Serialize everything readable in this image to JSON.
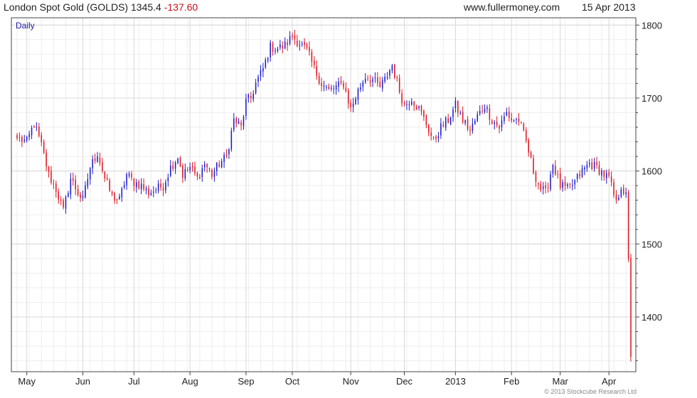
{
  "header": {
    "instrument": "London Spot Gold (GOLDS)",
    "last": "1345.4",
    "change": "-137.60",
    "site": "www.fullermoney.com",
    "date": "15 Apr 2013"
  },
  "footer": {
    "copyright": "© 2013 Stockcube Research Ltd"
  },
  "colors": {
    "up": "#1a1acc",
    "down": "#e0141e",
    "grid": "#d8d8d8",
    "frame": "#444444"
  },
  "chart_data": {
    "type": "candlestick",
    "period_label": "Daily",
    "ylim": [
      1325,
      1810
    ],
    "y_ticks": [
      1400,
      1500,
      1600,
      1700,
      1800
    ],
    "y_axis_side": "right",
    "grid": true,
    "x_ticks": [
      {
        "label": "May",
        "day": 4
      },
      {
        "label": "Jun",
        "day": 27
      },
      {
        "label": "Jul",
        "day": 48
      },
      {
        "label": "Aug",
        "day": 71
      },
      {
        "label": "Sep",
        "day": 94
      },
      {
        "label": "Oct",
        "day": 113
      },
      {
        "label": "Nov",
        "day": 137
      },
      {
        "label": "Dec",
        "day": 159
      },
      {
        "label": "2013",
        "day": 180
      },
      {
        "label": "Feb",
        "day": 203
      },
      {
        "label": "Mar",
        "day": 223
      },
      {
        "label": "Apr",
        "day": 243
      }
    ],
    "series": [
      {
        "comment": "",
        "close_path": [
          [
            0,
            1645
          ],
          [
            4,
            1640
          ],
          [
            7,
            1665
          ],
          [
            10,
            1635
          ],
          [
            13,
            1595
          ],
          [
            16,
            1575
          ],
          [
            19,
            1545
          ],
          [
            22,
            1590
          ],
          [
            25,
            1570
          ],
          [
            27,
            1560
          ],
          [
            30,
            1605
          ],
          [
            33,
            1625
          ],
          [
            36,
            1590
          ],
          [
            39,
            1565
          ],
          [
            42,
            1560
          ],
          [
            45,
            1595
          ],
          [
            48,
            1585
          ],
          [
            51,
            1580
          ],
          [
            54,
            1570
          ],
          [
            57,
            1575
          ],
          [
            60,
            1580
          ],
          [
            63,
            1605
          ],
          [
            66,
            1620
          ],
          [
            68,
            1595
          ],
          [
            71,
            1605
          ],
          [
            74,
            1590
          ],
          [
            77,
            1610
          ],
          [
            80,
            1595
          ],
          [
            83,
            1610
          ],
          [
            86,
            1620
          ],
          [
            89,
            1670
          ],
          [
            92,
            1660
          ],
          [
            94,
            1695
          ],
          [
            96,
            1700
          ],
          [
            98,
            1720
          ],
          [
            101,
            1740
          ],
          [
            104,
            1770
          ],
          [
            107,
            1768
          ],
          [
            110,
            1772
          ],
          [
            113,
            1785
          ],
          [
            116,
            1775
          ],
          [
            119,
            1765
          ],
          [
            122,
            1740
          ],
          [
            125,
            1720
          ],
          [
            128,
            1710
          ],
          [
            131,
            1715
          ],
          [
            134,
            1720
          ],
          [
            137,
            1685
          ],
          [
            140,
            1710
          ],
          [
            143,
            1730
          ],
          [
            146,
            1725
          ],
          [
            149,
            1715
          ],
          [
            151,
            1725
          ],
          [
            154,
            1745
          ],
          [
            157,
            1710
          ],
          [
            159,
            1690
          ],
          [
            162,
            1700
          ],
          [
            165,
            1685
          ],
          [
            168,
            1665
          ],
          [
            171,
            1640
          ],
          [
            174,
            1660
          ],
          [
            177,
            1670
          ],
          [
            180,
            1690
          ],
          [
            183,
            1670
          ],
          [
            186,
            1655
          ],
          [
            189,
            1675
          ],
          [
            192,
            1690
          ],
          [
            195,
            1670
          ],
          [
            198,
            1660
          ],
          [
            201,
            1680
          ],
          [
            203,
            1670
          ],
          [
            206,
            1670
          ],
          [
            209,
            1640
          ],
          [
            212,
            1600
          ],
          [
            215,
            1575
          ],
          [
            217,
            1570
          ],
          [
            220,
            1610
          ],
          [
            223,
            1580
          ],
          [
            226,
            1575
          ],
          [
            229,
            1585
          ],
          [
            232,
            1600
          ],
          [
            235,
            1610
          ],
          [
            238,
            1605
          ],
          [
            241,
            1595
          ],
          [
            243,
            1590
          ],
          [
            246,
            1555
          ],
          [
            248,
            1580
          ],
          [
            250,
            1565
          ],
          [
            251,
            1480
          ],
          [
            252,
            1345.4
          ]
        ]
      }
    ]
  }
}
